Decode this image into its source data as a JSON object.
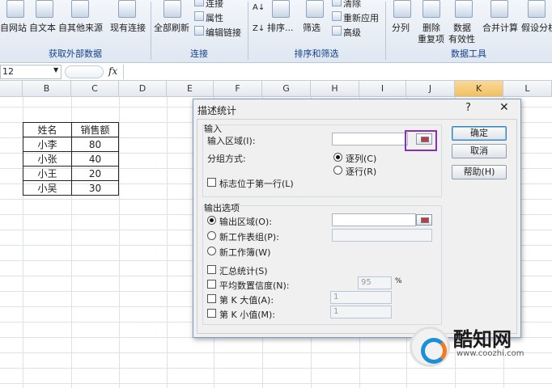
{
  "ribbon": {
    "buttons": [
      "自网站",
      "自文本",
      "自其他来源",
      "现有连接",
      "全部刷新",
      "连接",
      "属性",
      "编辑链接",
      "排序...",
      "筛选",
      "清除",
      "重新应用",
      "高级",
      "分列",
      "删除",
      "重复项",
      "数据",
      "有效性",
      "合并计算",
      "假设分析"
    ],
    "groups": [
      "获取外部数据",
      "连接",
      "排序和筛选",
      "数据工具"
    ]
  },
  "formula_bar": {
    "name_box": "12",
    "fx": "fx"
  },
  "columns": [
    "B",
    "C",
    "D",
    "E",
    "F",
    "G",
    "H",
    "I",
    "J",
    "K",
    "L"
  ],
  "table": {
    "headers": [
      "姓名",
      "销售额"
    ],
    "rows": [
      [
        "小李",
        "80"
      ],
      [
        "小张",
        "40"
      ],
      [
        "小王",
        "20"
      ],
      [
        "小吴",
        "30"
      ]
    ]
  },
  "dialog": {
    "title": "描述统计",
    "help": "?",
    "close": "✕",
    "input_section": "输入",
    "input_range_label": "输入区域(I):",
    "group_by_label": "分组方式:",
    "by_column": "逐列(C)",
    "by_row": "逐行(R)",
    "labels_first_row": "标志位于第一行(L)",
    "output_section": "输出选项",
    "output_range": "输出区域(O):",
    "new_sheet": "新工作表组(P):",
    "new_workbook": "新工作簿(W)",
    "summary_stats": "汇总统计(S)",
    "confidence": "平均数置信度(N):",
    "confidence_value": "95",
    "percent": "%",
    "kth_largest": "第 K 大值(A):",
    "kth_largest_value": "1",
    "kth_smallest": "第 K 小值(M):",
    "kth_smallest_value": "1",
    "ok": "确定",
    "cancel": "取消",
    "help_btn": "帮助(H)"
  },
  "watermark": {
    "name": "酷知网",
    "url": "www.coozhi.com"
  }
}
